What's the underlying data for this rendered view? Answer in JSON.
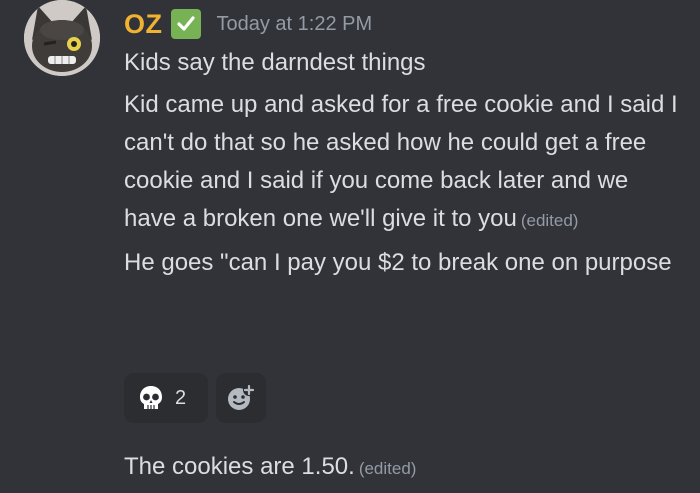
{
  "message": {
    "author": "OZ",
    "timestamp": "Today at 1:22 PM",
    "icons": {
      "avatar": "cat-avatar-icon",
      "verified_badge": "white-check-mark-icon",
      "reaction_emoji": "skull-icon",
      "add_reaction": "add-reaction-smiley-icon"
    },
    "lines": [
      {
        "text": "Kids say the darndest things",
        "edited": ""
      },
      {
        "text": "Kid came up and asked for a free cookie and I said I can't do that so he asked how he could get a free cookie and I said if you come back later and we have a broken one we'll give it to you",
        "edited": "(edited)"
      },
      {
        "text": "He goes \"can I pay you $2 to break one on purpose",
        "edited": ""
      }
    ],
    "reactions": [
      {
        "emoji": "skull",
        "count": "2"
      }
    ],
    "followup": {
      "text": "The cookies are 1.50.",
      "edited": "(edited)"
    }
  },
  "colors": {
    "background": "#313338",
    "username": "#f0b232",
    "text": "#dbdee1",
    "muted": "#949ba4",
    "reaction_bg": "#2b2d31",
    "verified_green": "#77b255"
  }
}
